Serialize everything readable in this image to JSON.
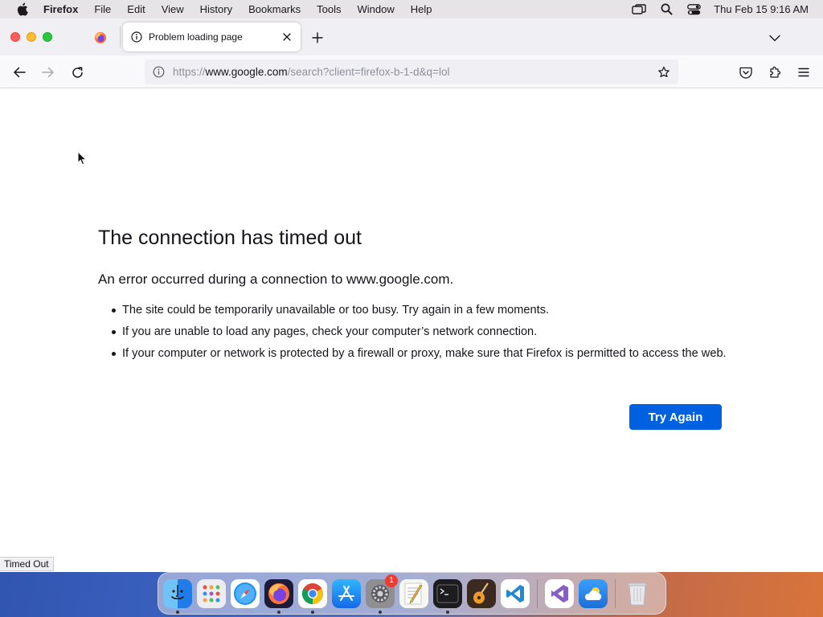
{
  "menubar": {
    "app_name": "Firefox",
    "items": [
      "File",
      "Edit",
      "View",
      "History",
      "Bookmarks",
      "Tools",
      "Window",
      "Help"
    ],
    "clock": "Thu Feb 15  9:16 AM"
  },
  "tab": {
    "title": "Problem loading page"
  },
  "urlbar": {
    "prefix": "https://",
    "host": "www.google.com",
    "path": "/search?client=firefox-b-1-d&q=lol"
  },
  "error": {
    "title": "The connection has timed out",
    "lead": "An error occurred during a connection to www.google.com.",
    "bullets": [
      "The site could be temporarily unavailable or too busy. Try again in a few moments.",
      "If you are unable to load any pages, check your computer’s network connection.",
      "If your computer or network is protected by a firewall or proxy, make sure that Firefox is permitted to access the web."
    ],
    "button": "Try Again"
  },
  "status_tip": "Timed Out",
  "dock": {
    "settings_badge": "1"
  },
  "colors": {
    "accent": "#0061e0",
    "menubar": "#e6e4e6",
    "tabbar": "#f0f0f4"
  }
}
